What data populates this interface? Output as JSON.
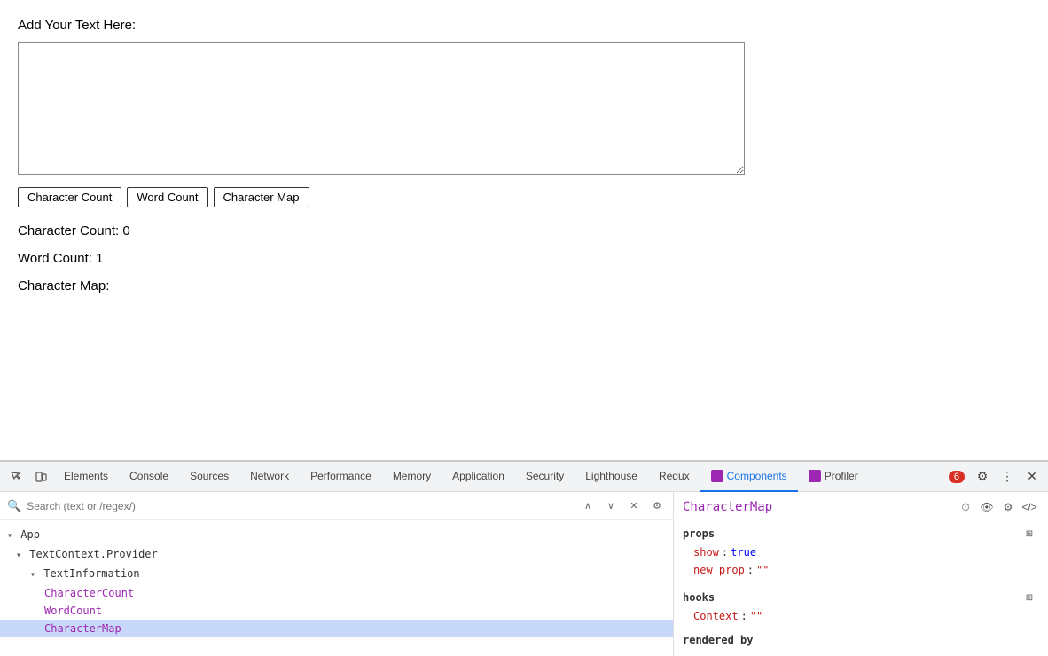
{
  "app": {
    "label": "Add Your Text Here:",
    "textarea": {
      "placeholder": ""
    },
    "buttons": [
      {
        "id": "char-count-btn",
        "label": "Character Count"
      },
      {
        "id": "word-count-btn",
        "label": "Word Count"
      },
      {
        "id": "char-map-btn",
        "label": "Character Map"
      }
    ],
    "results": {
      "char_count_label": "Character Count: 0",
      "word_count_label": "Word Count: 1",
      "char_map_label": "Character Map:"
    }
  },
  "devtools": {
    "tabs": [
      {
        "label": "Elements",
        "active": false
      },
      {
        "label": "Console",
        "active": false
      },
      {
        "label": "Sources",
        "active": false
      },
      {
        "label": "Network",
        "active": false
      },
      {
        "label": "Performance",
        "active": false
      },
      {
        "label": "Memory",
        "active": false
      },
      {
        "label": "Application",
        "active": false
      },
      {
        "label": "Security",
        "active": false
      },
      {
        "label": "Lighthouse",
        "active": false
      },
      {
        "label": "Redux",
        "active": false
      },
      {
        "label": "Components",
        "active": true,
        "icon": true
      },
      {
        "label": "Profiler",
        "active": false,
        "icon": true
      }
    ],
    "error_count": "6",
    "search": {
      "placeholder": "Search (text or /regex/)"
    },
    "tree": {
      "items": [
        {
          "indent": 0,
          "arrow": "▾",
          "label": "App",
          "component": false,
          "plain": true,
          "selected": false
        },
        {
          "indent": 1,
          "arrow": "▾",
          "label": "TextContext.Provider",
          "component": false,
          "plain": true,
          "selected": false
        },
        {
          "indent": 2,
          "arrow": "▾",
          "label": "TextInformation",
          "component": false,
          "plain": true,
          "selected": false
        },
        {
          "indent": 3,
          "arrow": "",
          "label": "CharacterCount",
          "component": true,
          "selected": false
        },
        {
          "indent": 3,
          "arrow": "",
          "label": "WordCount",
          "component": true,
          "selected": false
        },
        {
          "indent": 3,
          "arrow": "",
          "label": "CharacterMap",
          "component": true,
          "selected": true
        }
      ]
    },
    "right_panel": {
      "component_name": "CharacterMap",
      "props": {
        "title": "props",
        "items": [
          {
            "key": "show",
            "colon": ":",
            "value": "true",
            "type": "bool"
          },
          {
            "key": "new prop",
            "colon": ":",
            "value": "\"\"",
            "type": "str"
          }
        ]
      },
      "hooks": {
        "title": "hooks",
        "items": [
          {
            "key": "Context",
            "colon": ":",
            "value": "\"\"",
            "type": "str"
          }
        ]
      },
      "rendered_by": "rendered by"
    }
  }
}
